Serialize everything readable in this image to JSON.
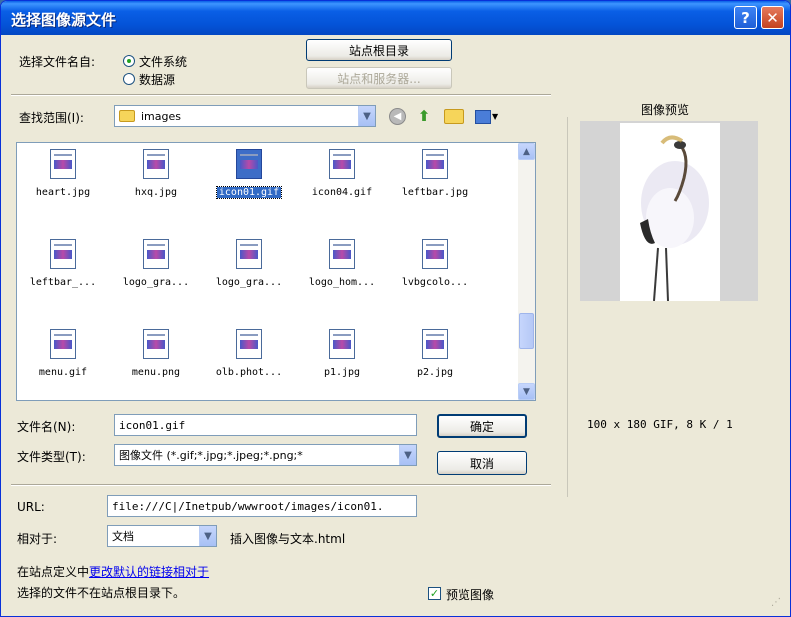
{
  "window": {
    "title": "选择图像源文件"
  },
  "select_from": {
    "label": "选择文件名自:",
    "options": [
      "文件系统",
      "数据源"
    ],
    "selected": 0
  },
  "buttons": {
    "site_root": "站点根目录",
    "site_server": "站点和服务器...",
    "ok": "确定",
    "cancel": "取消"
  },
  "look_in": {
    "label": "查找范围(I):",
    "value": "images"
  },
  "files": [
    {
      "name": "heart.jpg",
      "selected": false
    },
    {
      "name": "hxq.jpg",
      "selected": false
    },
    {
      "name": "icon01.gif",
      "selected": true
    },
    {
      "name": "icon04.gif",
      "selected": false
    },
    {
      "name": "leftbar.jpg",
      "selected": false
    },
    {
      "name": "leftbar_...",
      "selected": false
    },
    {
      "name": "logo_gra...",
      "selected": false
    },
    {
      "name": "logo_gra...",
      "selected": false
    },
    {
      "name": "logo_hom...",
      "selected": false
    },
    {
      "name": "lvbgcolo...",
      "selected": false
    },
    {
      "name": "menu.gif",
      "selected": false
    },
    {
      "name": "menu.png",
      "selected": false
    },
    {
      "name": "olb.phot...",
      "selected": false
    },
    {
      "name": "p1.jpg",
      "selected": false
    },
    {
      "name": "p2.jpg",
      "selected": false
    }
  ],
  "filename": {
    "label": "文件名(N):",
    "value": "icon01.gif"
  },
  "filetype": {
    "label": "文件类型(T):",
    "value": "图像文件 (*.gif;*.jpg;*.jpeg;*.png;*"
  },
  "url": {
    "label": "URL:",
    "value": "file:///C|/Inetpub/wwwroot/images/icon01."
  },
  "relative": {
    "label": "相对于:",
    "value": "文档",
    "note": "插入图像与文本.html"
  },
  "footer": {
    "site_def_prefix": "在站点定义中",
    "site_def_link": "更改默认的链接相对于",
    "warning": "选择的文件不在站点根目录下。",
    "preview_checkbox": "预览图像"
  },
  "preview": {
    "title": "图像预览",
    "info": "100 x 180 GIF, 8 K / 1"
  },
  "colors": {
    "titlebar": "#0a5fe6",
    "selection": "#316ac5",
    "dialog_bg": "#ece9d8"
  }
}
